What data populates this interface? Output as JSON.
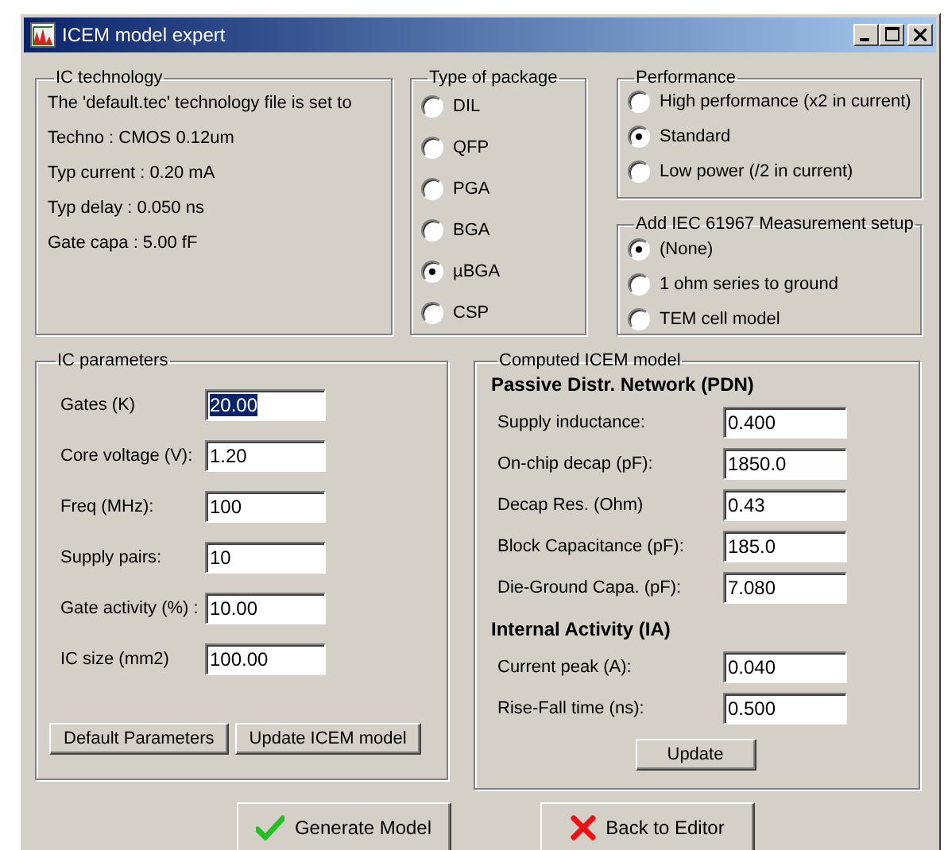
{
  "window": {
    "title": "ICEM model expert"
  },
  "ic_technology": {
    "title": "IC technology",
    "lines": [
      "The 'default.tec'  technology file is set to",
      "Techno : CMOS 0.12um",
      "Typ current : 0.20 mA",
      "Typ delay : 0.050 ns",
      "Gate capa : 5.00 fF"
    ]
  },
  "package": {
    "title": "Type of package",
    "options": [
      {
        "label": "DIL",
        "selected": false
      },
      {
        "label": "QFP",
        "selected": false
      },
      {
        "label": "PGA",
        "selected": false
      },
      {
        "label": "BGA",
        "selected": false
      },
      {
        "label": "µBGA",
        "selected": true
      },
      {
        "label": "CSP",
        "selected": false
      }
    ]
  },
  "performance": {
    "title": "Performance",
    "options": [
      {
        "label": "High performance (x2 in current)",
        "selected": false
      },
      {
        "label": "Standard",
        "selected": true
      },
      {
        "label": "Low power (/2 in current)",
        "selected": false
      }
    ]
  },
  "measurement_setup": {
    "title": "Add IEC 61967 Measurement setup",
    "options": [
      {
        "label": "(None)",
        "selected": true
      },
      {
        "label": "1 ohm series to ground",
        "selected": false
      },
      {
        "label": "TEM cell model",
        "selected": false
      }
    ]
  },
  "ic_parameters": {
    "title": "IC parameters",
    "fields": [
      {
        "label": "Gates (K)",
        "value": "20.00",
        "selected": true
      },
      {
        "label": "Core voltage (V):",
        "value": "1.20",
        "selected": false
      },
      {
        "label": "Freq (MHz):",
        "value": "100",
        "selected": false
      },
      {
        "label": "Supply pairs:",
        "value": "10",
        "selected": false
      },
      {
        "label": "Gate activity (%) :",
        "value": "10.00",
        "selected": false
      },
      {
        "label": "IC size (mm2)",
        "value": "100.00",
        "selected": false
      }
    ],
    "buttons": [
      "Default Parameters",
      "Update ICEM model"
    ]
  },
  "computed_model": {
    "title": "Computed ICEM model",
    "sections": [
      {
        "heading": "Passive Distr. Network (PDN)",
        "fields": [
          {
            "label": "Supply inductance:",
            "value": "0.400"
          },
          {
            "label": "On-chip decap (pF):",
            "value": "1850.0"
          },
          {
            "label": "Decap Res. (Ohm)",
            "value": "0.43"
          },
          {
            "label": "Block Capacitance (pF):",
            "value": "185.0"
          },
          {
            "label": "Die-Ground Capa. (pF):",
            "value": "7.080"
          }
        ]
      },
      {
        "heading": "Internal Activity (IA)",
        "fields": [
          {
            "label": "Current peak (A):",
            "value": "0.040"
          },
          {
            "label": "Rise-Fall time (ns):",
            "value": "0.500"
          }
        ]
      }
    ],
    "button": "Update"
  },
  "buttons": [
    {
      "label": "Generate Model",
      "kind": "ok"
    },
    {
      "label": "Back to Editor",
      "kind": "cancel"
    }
  ]
}
